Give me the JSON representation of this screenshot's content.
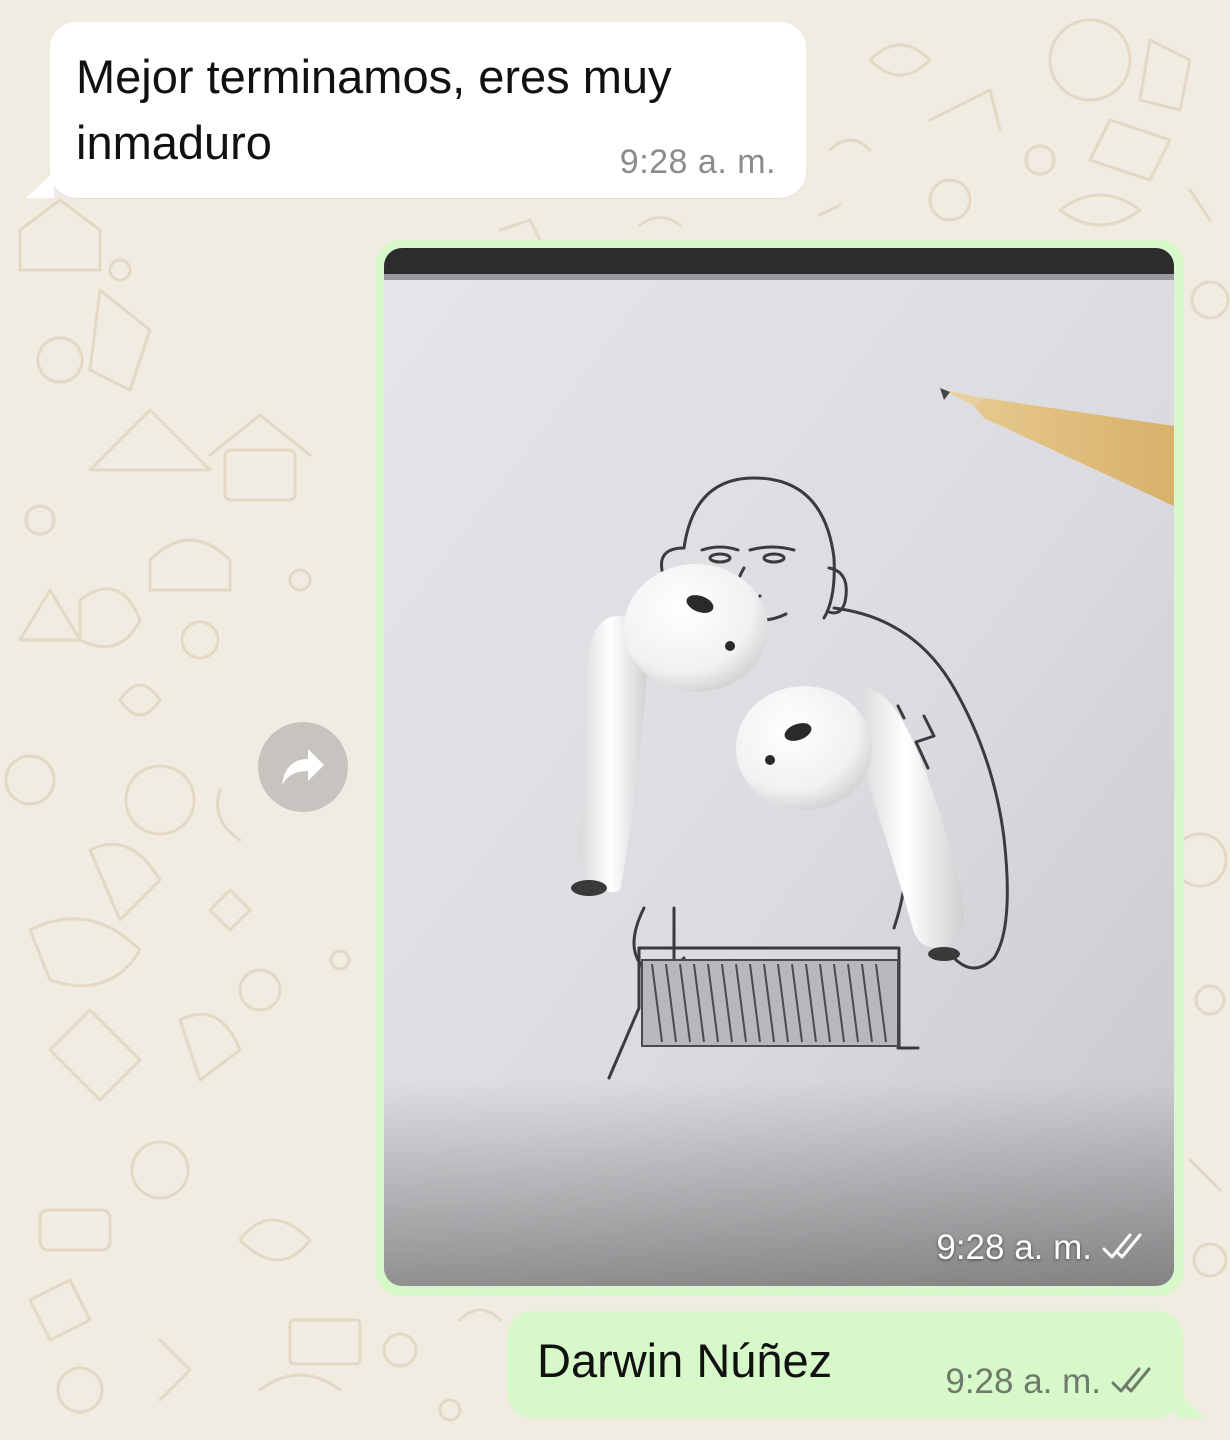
{
  "chat": {
    "incoming_message": {
      "text": "Mejor terminamos, eres muy inmaduro",
      "time": "9:28 a. m."
    },
    "image_message": {
      "time": "9:28 a. m.",
      "status_icon": "double-check-icon",
      "description_icon": "airpods-drawing-photo"
    },
    "outgoing_message": {
      "text": "Darwin Núñez",
      "time": "9:28 a. m.",
      "status_icon": "double-check-icon"
    },
    "forward_icon": "forward-arrow-icon"
  },
  "colors": {
    "chat_background": "#f1ece1",
    "incoming_bubble": "#ffffff",
    "outgoing_bubble": "#d7f9c9",
    "forward_button": "#c7c4c0"
  }
}
